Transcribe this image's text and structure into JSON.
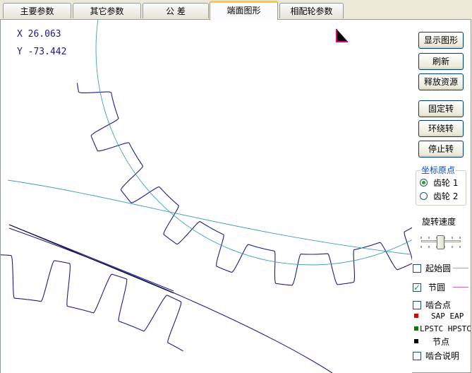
{
  "tabs": [
    {
      "label": "主要参数",
      "active": false
    },
    {
      "label": "其它参数",
      "active": false
    },
    {
      "label": "公 差",
      "active": false
    },
    {
      "label": "端面图形",
      "active": true
    },
    {
      "label": "相配轮参数",
      "active": false
    }
  ],
  "drawing": {
    "coord_x": "X 26.063",
    "coord_y": "Y -73.442",
    "axis_marker_color": "#e0007a",
    "curve_color": "#1c1c8c",
    "circle_color": "#3ea0b4"
  },
  "buttons": {
    "show_graph": "显示图形",
    "refresh": "刷新",
    "release": "释放资源",
    "fixed_rotate": "固定转",
    "orbit_rotate": "环绕转",
    "stop_rotate": "停止转"
  },
  "origin_group": {
    "title": "坐标原点",
    "options": [
      {
        "label": "齿轮 1",
        "selected": true
      },
      {
        "label": "齿轮 2",
        "selected": false
      }
    ]
  },
  "speed": {
    "label": "旋转速度",
    "level": 0.5
  },
  "options": [
    {
      "label": "起始圆",
      "checked": false,
      "color": "#f0a030"
    },
    {
      "label": "节圆",
      "checked": true,
      "color": "#e060c8"
    },
    {
      "label": "啮合点",
      "checked": false
    }
  ],
  "legend": [
    {
      "label": "SAP EAP",
      "color": "#e00000"
    },
    {
      "label": "LPSTC HPSTC",
      "color": "#008000"
    },
    {
      "label": "节点",
      "color": "#000000"
    }
  ],
  "mesh_note": {
    "label": "啮合说明",
    "checked": false
  }
}
